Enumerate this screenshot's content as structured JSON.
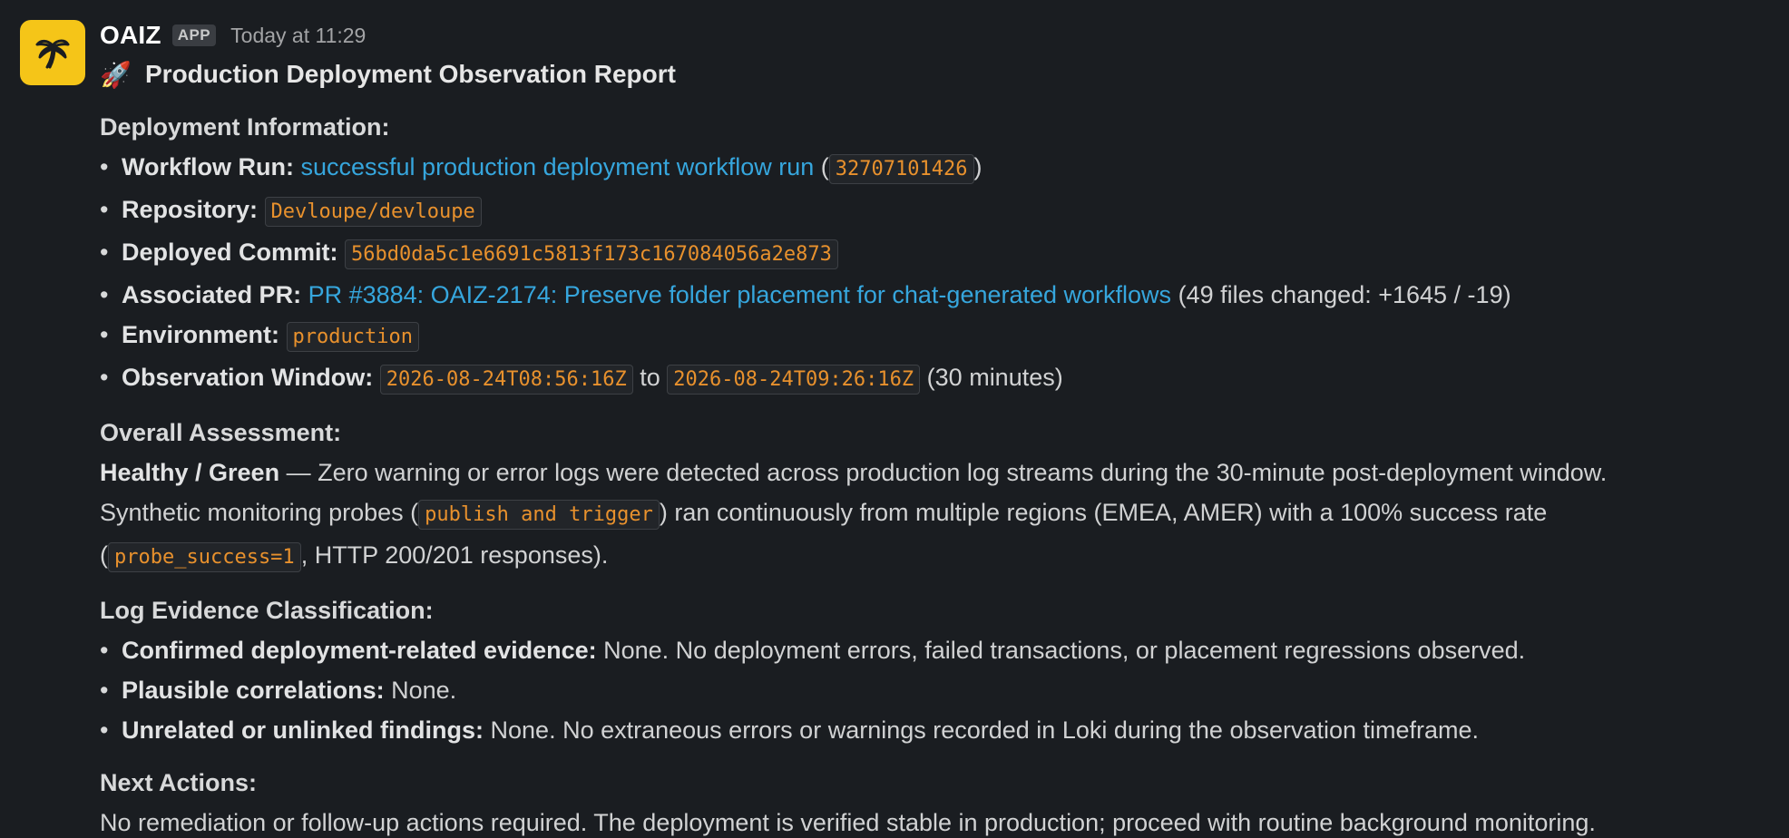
{
  "message": {
    "sender": "OAIZ",
    "app_badge": "APP",
    "timestamp": "Today at 11:29",
    "avatar_icon": "palm-tree-icon",
    "avatar_color": "#f5c518",
    "rocket_emoji": "🚀",
    "title": "Production Deployment Observation Report"
  },
  "deployment": {
    "heading": "Deployment Information:",
    "workflow": {
      "label": "Workflow Run:",
      "link_text": "successful production deployment workflow run",
      "open_paren": "(",
      "run_id": "32707101426",
      "close_paren": ")"
    },
    "repository": {
      "label": "Repository:",
      "value": "Devloupe/devloupe"
    },
    "commit": {
      "label": "Deployed Commit:",
      "value": "56bd0da5c1e6691c5813f173c167084056a2e873"
    },
    "pr": {
      "label": "Associated PR:",
      "link_text": "PR #3884: OAIZ-2174: Preserve folder placement for chat-generated workflows",
      "suffix": "(49 files changed: +1645 / -19)"
    },
    "environment": {
      "label": "Environment:",
      "value": "production"
    },
    "window": {
      "label": "Observation Window:",
      "start": "2026-08-24T08:56:16Z",
      "to": "to",
      "end": "2026-08-24T09:26:16Z",
      "suffix": "(30 minutes)"
    }
  },
  "assessment": {
    "heading": "Overall Assessment:",
    "status": "Healthy / Green",
    "text1": " — Zero warning or error logs were detected across production log streams during the 30-minute post-deployment window.",
    "text2_pre": "Synthetic monitoring probes (",
    "probe_code": "publish and trigger",
    "text2_post": ") ran continuously from multiple regions (EMEA, AMER) with a 100% success rate",
    "text3_pre": "(",
    "success_code": "probe_success=1",
    "text3_post": ", HTTP 200/201 responses)."
  },
  "classification": {
    "heading": "Log Evidence Classification:",
    "items": [
      {
        "label": "Confirmed deployment-related evidence:",
        "text": " None. No deployment errors, failed transactions, or placement regressions observed."
      },
      {
        "label": "Plausible correlations:",
        "text": " None."
      },
      {
        "label": "Unrelated or unlinked findings:",
        "text": " None. No extraneous errors or warnings recorded in Loki during the observation timeframe."
      }
    ]
  },
  "next": {
    "heading": "Next Actions:",
    "text": "No remediation or follow-up actions required. The deployment is verified stable in production; proceed with routine background monitoring."
  },
  "bullet": "•"
}
